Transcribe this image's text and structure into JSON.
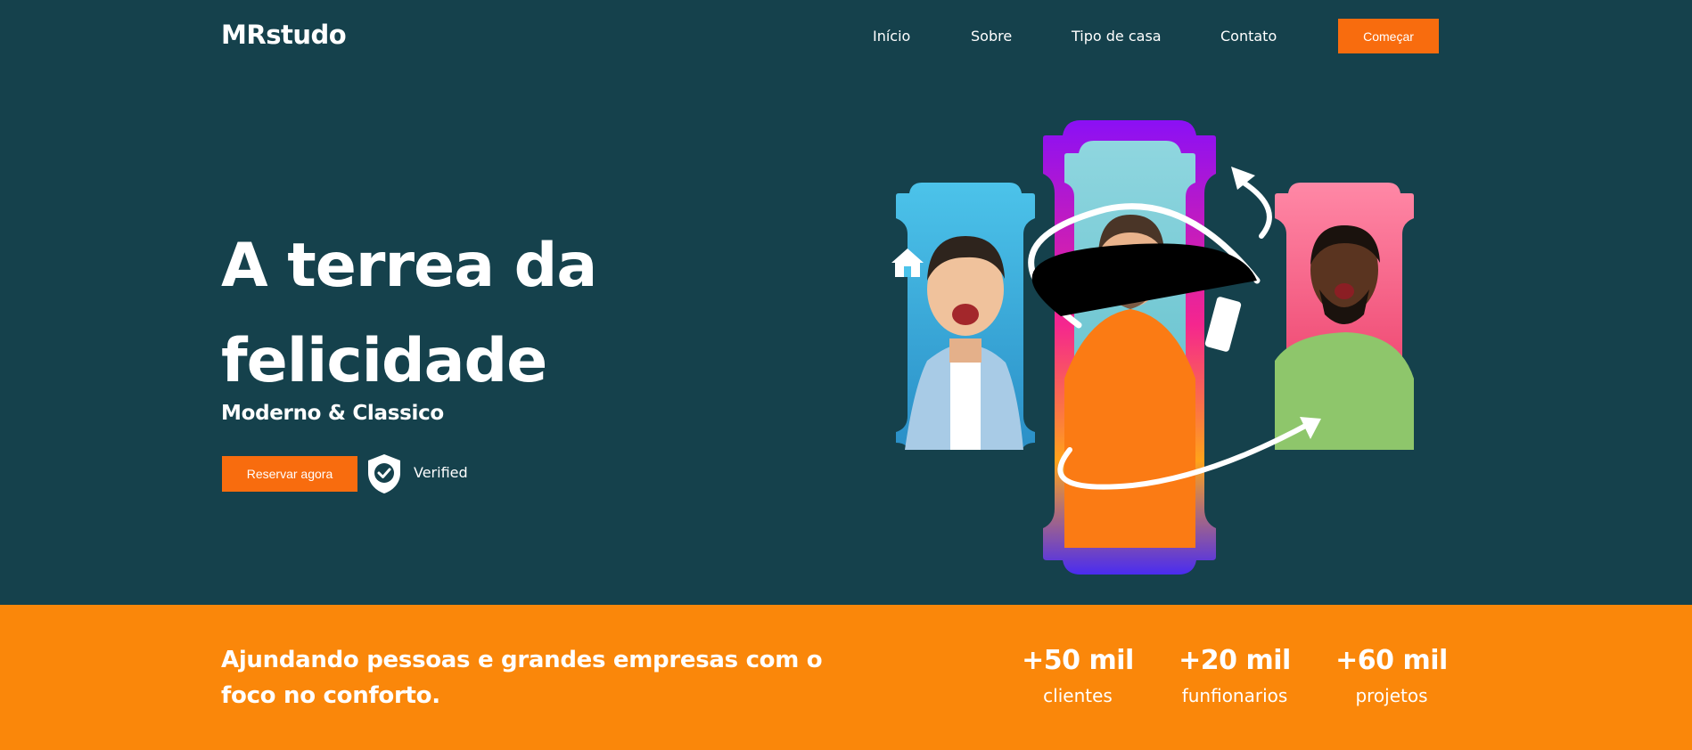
{
  "header": {
    "logo": "MRstudo",
    "nav": [
      "Início",
      "Sobre",
      "Tipo de casa",
      "Contato"
    ],
    "cta": "Começar"
  },
  "hero": {
    "title": "A terrea da felicidade",
    "subtitle": "Moderno & Classico",
    "book_button": "Reservar agora",
    "verified": "Verified"
  },
  "stats": {
    "tagline": "Ajundando pessoas e grandes empresas com o foco no conforto.",
    "items": [
      {
        "value": "+50 mil",
        "label": "clientes"
      },
      {
        "value": "+20 mil",
        "label": "funfionarios"
      },
      {
        "value": "+60 mil",
        "label": "projetos"
      }
    ]
  },
  "colors": {
    "background": "#15414c",
    "accent": "#f86c0e",
    "stats_bar": "#fa870a"
  },
  "icons": [
    "shield-check-icon",
    "house-icon",
    "curved-arrow-icon"
  ]
}
